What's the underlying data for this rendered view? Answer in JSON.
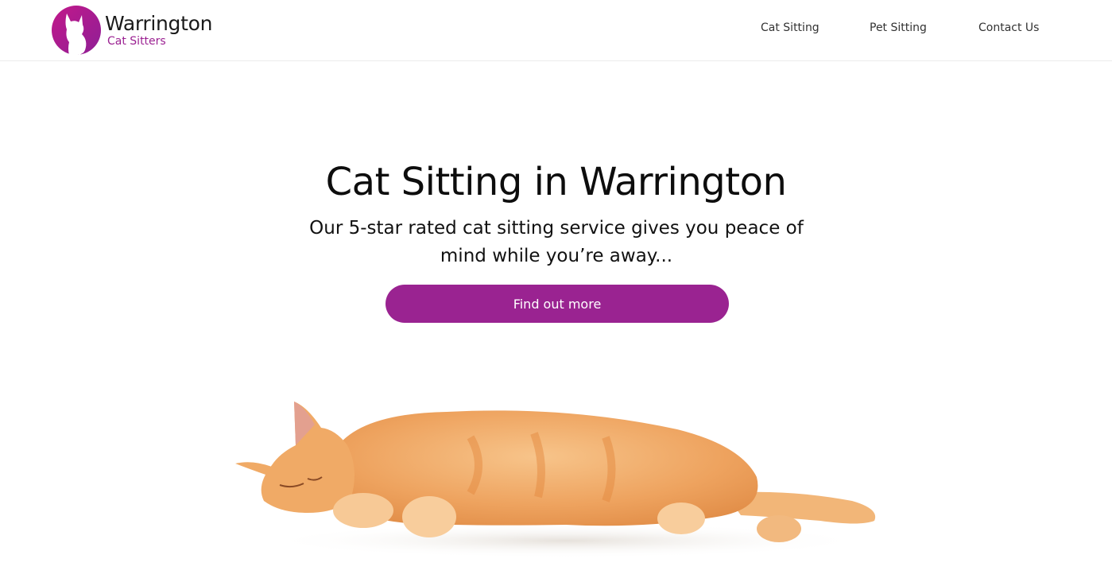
{
  "brand": {
    "name": "Warrington",
    "tagline": "Cat Sitters",
    "accent_color": "#9b2192",
    "logo_icon": "cat-silhouette-icon"
  },
  "nav": {
    "items": [
      {
        "label": "Cat Sitting"
      },
      {
        "label": "Pet Sitting"
      },
      {
        "label": "Contact Us"
      }
    ]
  },
  "hero": {
    "title": "Cat Sitting in Warrington",
    "subtitle": "Our 5-star rated cat sitting service gives you peace of mind while you’re away...",
    "cta_label": "Find out more",
    "cta_color": "#9a2391",
    "image": "sleeping-ginger-cat-photo"
  }
}
